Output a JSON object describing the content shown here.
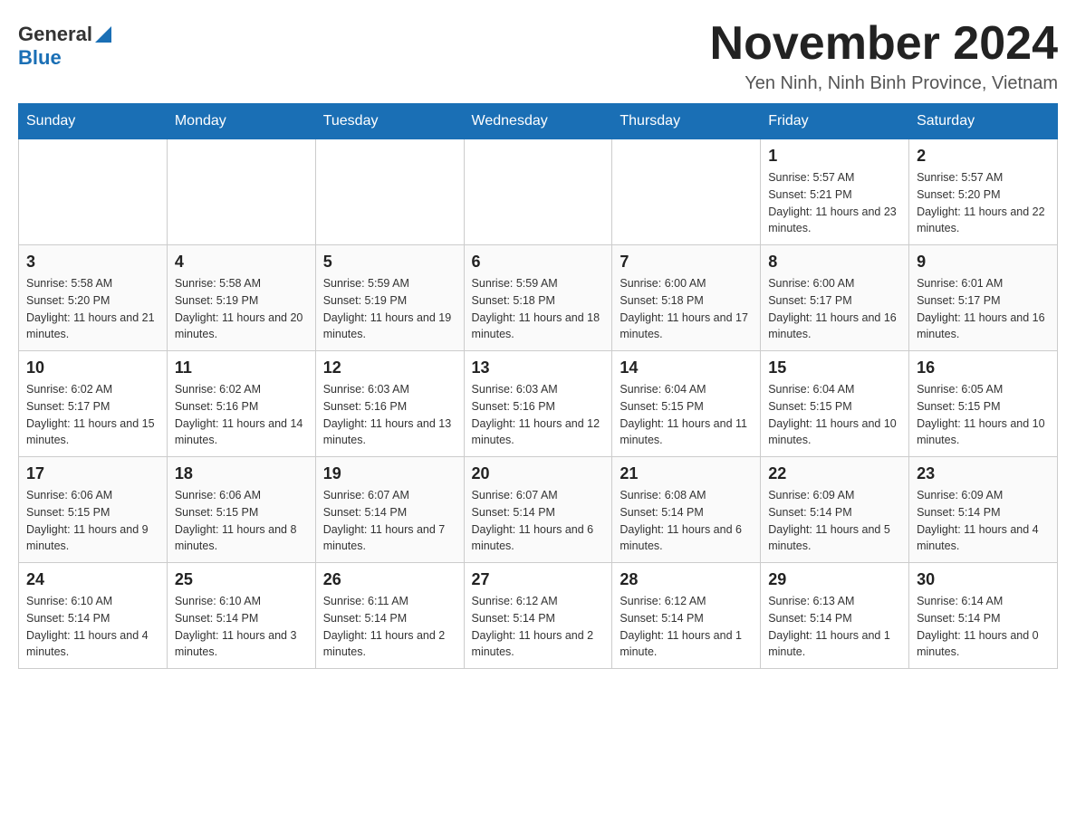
{
  "header": {
    "logo_general": "General",
    "logo_blue": "Blue",
    "title": "November 2024",
    "subtitle": "Yen Ninh, Ninh Binh Province, Vietnam"
  },
  "weekdays": [
    "Sunday",
    "Monday",
    "Tuesday",
    "Wednesday",
    "Thursday",
    "Friday",
    "Saturday"
  ],
  "weeks": [
    [
      {
        "day": "",
        "info": ""
      },
      {
        "day": "",
        "info": ""
      },
      {
        "day": "",
        "info": ""
      },
      {
        "day": "",
        "info": ""
      },
      {
        "day": "",
        "info": ""
      },
      {
        "day": "1",
        "info": "Sunrise: 5:57 AM\nSunset: 5:21 PM\nDaylight: 11 hours and 23 minutes."
      },
      {
        "day": "2",
        "info": "Sunrise: 5:57 AM\nSunset: 5:20 PM\nDaylight: 11 hours and 22 minutes."
      }
    ],
    [
      {
        "day": "3",
        "info": "Sunrise: 5:58 AM\nSunset: 5:20 PM\nDaylight: 11 hours and 21 minutes."
      },
      {
        "day": "4",
        "info": "Sunrise: 5:58 AM\nSunset: 5:19 PM\nDaylight: 11 hours and 20 minutes."
      },
      {
        "day": "5",
        "info": "Sunrise: 5:59 AM\nSunset: 5:19 PM\nDaylight: 11 hours and 19 minutes."
      },
      {
        "day": "6",
        "info": "Sunrise: 5:59 AM\nSunset: 5:18 PM\nDaylight: 11 hours and 18 minutes."
      },
      {
        "day": "7",
        "info": "Sunrise: 6:00 AM\nSunset: 5:18 PM\nDaylight: 11 hours and 17 minutes."
      },
      {
        "day": "8",
        "info": "Sunrise: 6:00 AM\nSunset: 5:17 PM\nDaylight: 11 hours and 16 minutes."
      },
      {
        "day": "9",
        "info": "Sunrise: 6:01 AM\nSunset: 5:17 PM\nDaylight: 11 hours and 16 minutes."
      }
    ],
    [
      {
        "day": "10",
        "info": "Sunrise: 6:02 AM\nSunset: 5:17 PM\nDaylight: 11 hours and 15 minutes."
      },
      {
        "day": "11",
        "info": "Sunrise: 6:02 AM\nSunset: 5:16 PM\nDaylight: 11 hours and 14 minutes."
      },
      {
        "day": "12",
        "info": "Sunrise: 6:03 AM\nSunset: 5:16 PM\nDaylight: 11 hours and 13 minutes."
      },
      {
        "day": "13",
        "info": "Sunrise: 6:03 AM\nSunset: 5:16 PM\nDaylight: 11 hours and 12 minutes."
      },
      {
        "day": "14",
        "info": "Sunrise: 6:04 AM\nSunset: 5:15 PM\nDaylight: 11 hours and 11 minutes."
      },
      {
        "day": "15",
        "info": "Sunrise: 6:04 AM\nSunset: 5:15 PM\nDaylight: 11 hours and 10 minutes."
      },
      {
        "day": "16",
        "info": "Sunrise: 6:05 AM\nSunset: 5:15 PM\nDaylight: 11 hours and 10 minutes."
      }
    ],
    [
      {
        "day": "17",
        "info": "Sunrise: 6:06 AM\nSunset: 5:15 PM\nDaylight: 11 hours and 9 minutes."
      },
      {
        "day": "18",
        "info": "Sunrise: 6:06 AM\nSunset: 5:15 PM\nDaylight: 11 hours and 8 minutes."
      },
      {
        "day": "19",
        "info": "Sunrise: 6:07 AM\nSunset: 5:14 PM\nDaylight: 11 hours and 7 minutes."
      },
      {
        "day": "20",
        "info": "Sunrise: 6:07 AM\nSunset: 5:14 PM\nDaylight: 11 hours and 6 minutes."
      },
      {
        "day": "21",
        "info": "Sunrise: 6:08 AM\nSunset: 5:14 PM\nDaylight: 11 hours and 6 minutes."
      },
      {
        "day": "22",
        "info": "Sunrise: 6:09 AM\nSunset: 5:14 PM\nDaylight: 11 hours and 5 minutes."
      },
      {
        "day": "23",
        "info": "Sunrise: 6:09 AM\nSunset: 5:14 PM\nDaylight: 11 hours and 4 minutes."
      }
    ],
    [
      {
        "day": "24",
        "info": "Sunrise: 6:10 AM\nSunset: 5:14 PM\nDaylight: 11 hours and 4 minutes."
      },
      {
        "day": "25",
        "info": "Sunrise: 6:10 AM\nSunset: 5:14 PM\nDaylight: 11 hours and 3 minutes."
      },
      {
        "day": "26",
        "info": "Sunrise: 6:11 AM\nSunset: 5:14 PM\nDaylight: 11 hours and 2 minutes."
      },
      {
        "day": "27",
        "info": "Sunrise: 6:12 AM\nSunset: 5:14 PM\nDaylight: 11 hours and 2 minutes."
      },
      {
        "day": "28",
        "info": "Sunrise: 6:12 AM\nSunset: 5:14 PM\nDaylight: 11 hours and 1 minute."
      },
      {
        "day": "29",
        "info": "Sunrise: 6:13 AM\nSunset: 5:14 PM\nDaylight: 11 hours and 1 minute."
      },
      {
        "day": "30",
        "info": "Sunrise: 6:14 AM\nSunset: 5:14 PM\nDaylight: 11 hours and 0 minutes."
      }
    ]
  ]
}
